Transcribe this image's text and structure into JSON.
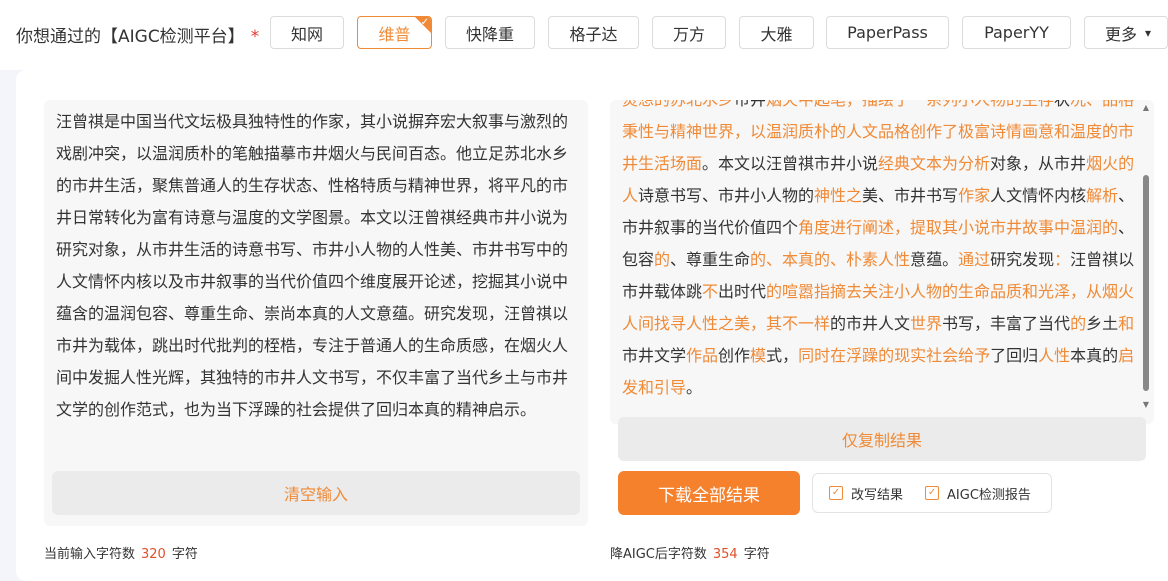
{
  "header": {
    "question": "你想通过的【AIGC检测平台】",
    "required_mark": "*",
    "platforms": [
      {
        "label": "知网",
        "active": false
      },
      {
        "label": "维普",
        "active": true
      },
      {
        "label": "快降重",
        "active": false
      },
      {
        "label": "格子达",
        "active": false
      },
      {
        "label": "万方",
        "active": false
      },
      {
        "label": "大雅",
        "active": false
      },
      {
        "label": "PaperPass",
        "active": false
      },
      {
        "label": "PaperYY",
        "active": false
      }
    ],
    "more_label": "更多"
  },
  "input": {
    "text": "汪曾祺是中国当代文坛极具独特性的作家，其小说摒弃宏大叙事与激烈的戏剧冲突，以温润质朴的笔触描摹市井烟火与民间百态。他立足苏北水乡的市井生活，聚焦普通人的生存状态、性格特质与精神世界，将平凡的市井日常转化为富有诗意与温度的文学图景。本文以汪曾祺经典市井小说为研究对象，从市井生活的诗意书写、市井小人物的人性美、市井书写中的人文情怀内核以及市井叙事的当代价值四个维度展开论述，挖掘其小说中蕴含的温润包容、尊重生命、崇尚本真的人文意蕴。研究发现，汪曾祺以市井为载体，跳出时代批判的桎梏，专注于普通人的生命质感，在烟火人间中发掘人性光辉，其独特的市井人文书写，不仅丰富了当代乡土与市井文学的创作范式，也为当下浮躁的社会提供了回归本真的精神启示。",
    "clear_label": "清空输入",
    "count_prefix": "当前输入字符数",
    "count_value": "320",
    "count_suffix": "字符"
  },
  "output": {
    "segments": [
      {
        "t": "熨想的苏北水乡",
        "hl": true
      },
      {
        "t": "市井",
        "hl": false
      },
      {
        "t": "烟火中起笔，描绘了一系列小人物的生存",
        "hl": true
      },
      {
        "t": "状",
        "hl": false
      },
      {
        "t": "况、品格秉性与精神世界，以温润质朴的人文品格创作了极富诗情画意和温度的市井生活场面",
        "hl": true
      },
      {
        "t": "。本文以汪曾祺市井小说",
        "hl": false
      },
      {
        "t": "经典文本为分析",
        "hl": true
      },
      {
        "t": "对象，从市井",
        "hl": false
      },
      {
        "t": "烟火的人",
        "hl": true
      },
      {
        "t": "诗意书写、市井小人物的",
        "hl": false
      },
      {
        "t": "神性之",
        "hl": true
      },
      {
        "t": "美、市井书写",
        "hl": false
      },
      {
        "t": "作家",
        "hl": true
      },
      {
        "t": "人文情怀内核",
        "hl": false
      },
      {
        "t": "解析",
        "hl": true
      },
      {
        "t": "、市井叙事的当代价值四个",
        "hl": false
      },
      {
        "t": "角度进行阐述，提取其小说市井故事中温润的",
        "hl": true
      },
      {
        "t": "、包容",
        "hl": false
      },
      {
        "t": "的",
        "hl": true
      },
      {
        "t": "、尊重生命",
        "hl": false
      },
      {
        "t": "的、本真的、朴素人性",
        "hl": true
      },
      {
        "t": "意蕴。",
        "hl": false
      },
      {
        "t": "通过",
        "hl": true
      },
      {
        "t": "研究发现",
        "hl": false
      },
      {
        "t": "：",
        "hl": true
      },
      {
        "t": "汪曾祺以市井载体跳",
        "hl": false
      },
      {
        "t": "不",
        "hl": true
      },
      {
        "t": "出时代",
        "hl": false
      },
      {
        "t": "的喧嚣指摘去关注小人物的生命品质和光泽，从烟火人间找寻人性之美，其不一样",
        "hl": true
      },
      {
        "t": "的市井人文",
        "hl": false
      },
      {
        "t": "世界",
        "hl": true
      },
      {
        "t": "书写，丰富了当代",
        "hl": false
      },
      {
        "t": "的",
        "hl": true
      },
      {
        "t": "乡土",
        "hl": false
      },
      {
        "t": "和",
        "hl": true
      },
      {
        "t": "市井文学",
        "hl": false
      },
      {
        "t": "作品",
        "hl": true
      },
      {
        "t": "创作",
        "hl": false
      },
      {
        "t": "模",
        "hl": true
      },
      {
        "t": "式，",
        "hl": false
      },
      {
        "t": "同时在浮躁的现实社会给予",
        "hl": true
      },
      {
        "t": "了回归",
        "hl": false
      },
      {
        "t": "人性",
        "hl": true
      },
      {
        "t": "本真的",
        "hl": false
      },
      {
        "t": "启发和引导",
        "hl": true
      },
      {
        "t": "。",
        "hl": false
      }
    ],
    "copy_label": "仅复制结果",
    "download_label": "下载全部结果",
    "options": [
      {
        "label": "改写结果",
        "checked": true
      },
      {
        "label": "AIGC检测报告",
        "checked": true
      }
    ],
    "count_prefix": "降AIGC后字符数",
    "count_value": "354",
    "count_suffix": "字符"
  },
  "colors": {
    "accent": "#f08a36",
    "download_bg": "#f5812d",
    "count_number": "#e0502a"
  }
}
